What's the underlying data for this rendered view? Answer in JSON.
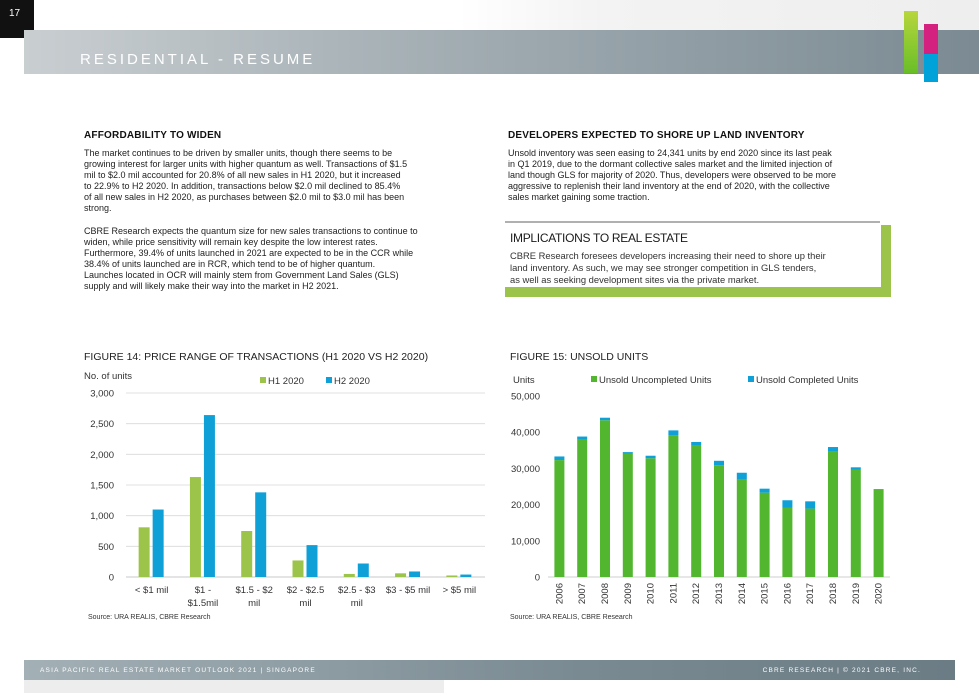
{
  "page": {
    "number": "17",
    "title": "RESIDENTIAL - RESUME"
  },
  "left_section": {
    "heading": "AFFORDABILITY TO WIDEN",
    "paragraph1": [
      "The market continues to be driven by smaller units, though there seems to be",
      "growing interest for larger units with higher quantum as well. Transactions of $1.5",
      "mil to $2.0 mil accounted for 20.8% of all new sales in H1 2020, but it increased",
      "to 22.9% to H2 2020. In addition, transactions below $2.0 mil declined to 85.4%",
      "of all new sales in H2 2020, as purchases between $2.0 mil to $3.0 mil has been",
      "strong."
    ],
    "paragraph2": [
      "CBRE Research expects the quantum size for new sales transactions to continue to",
      "widen, while price sensitivity will remain key despite the low interest rates.",
      "Furthermore, 39.4% of units launched in 2021 are expected to be in the CCR while",
      "38.4% of units launched are in RCR, which tend to be of higher quantum.",
      "Launches located in OCR will mainly stem from Government Land Sales (GLS)",
      "supply and will likely make their way into the market in H2 2021."
    ]
  },
  "right_section": {
    "heading": "DEVELOPERS EXPECTED TO SHORE UP LAND INVENTORY",
    "paragraph": [
      "Unsold inventory was seen easing to 24,341 units by end 2020 since its last peak",
      "in Q1 2019, due to the dormant collective sales market and the limited injection of",
      "land though GLS for majority of 2020. Thus, developers were observed to be more",
      "aggressive to replenish their land inventory at the end of 2020, with the collective",
      "sales market gaining some traction."
    ]
  },
  "implications": {
    "title": "IMPLICATIONS TO REAL ESTATE",
    "text": [
      "CBRE Research foresees developers increasing their need to shore up their",
      "land inventory. As such, we may see stronger competition in GLS tenders,",
      "as well as seeking development sites via the private market."
    ]
  },
  "figures": {
    "fig14_title": "FIGURE 14: PRICE RANGE OF TRANSACTIONS (H1 2020 VS H2 2020)",
    "fig14_source": "Source: URA REALIS, CBRE Research",
    "fig15_title": "FIGURE 15: UNSOLD UNITS",
    "fig15_source": "Source: URA REALIS, CBRE Research"
  },
  "footer": {
    "left": "ASIA PACIFIC REAL ESTATE MARKET OUTLOOK 2021 | SINGAPORE",
    "right": "CBRE RESEARCH | © 2021 CBRE, INC."
  },
  "colors": {
    "green": "#8dc63f",
    "blue": "#00a3d9",
    "bright_green": "#52b72f"
  },
  "chart_data": [
    {
      "type": "bar",
      "title": "FIGURE 14: PRICE RANGE OF TRANSACTIONS (H1 2020 VS H2 2020)",
      "ylabel": "No. of units",
      "xlabel": "",
      "categories": [
        [
          "< $1 mil"
        ],
        [
          "$1 -",
          "$1.5mil"
        ],
        [
          "$1.5 - $2",
          "mil"
        ],
        [
          "$2 - $2.5",
          "mil"
        ],
        [
          "$2.5 - $3",
          "mil"
        ],
        [
          "$3 - $5 mil"
        ],
        [
          "> $5 mil"
        ]
      ],
      "series": [
        {
          "name": "H1 2020",
          "color": "#9dc44a",
          "values": [
            810,
            1630,
            750,
            270,
            50,
            60,
            25
          ]
        },
        {
          "name": "H2 2020",
          "color": "#0fa0d7",
          "values": [
            1100,
            2640,
            1380,
            520,
            220,
            90,
            40
          ]
        }
      ],
      "ylim": [
        0,
        3000
      ],
      "yticks": [
        0,
        500,
        1000,
        1500,
        2000,
        2500,
        3000
      ],
      "ytick_labels": [
        "0",
        "500",
        "1,000",
        "1,500",
        "2,000",
        "2,500",
        "3,000"
      ],
      "grid": true,
      "legend": "top"
    },
    {
      "type": "bar",
      "stacked": true,
      "title": "FIGURE 15: UNSOLD UNITS",
      "ylabel": "Units",
      "xlabel": "",
      "categories": [
        "2006",
        "2007",
        "2008",
        "2009",
        "2010",
        "2011",
        "2012",
        "2013",
        "2014",
        "2015",
        "2016",
        "2017",
        "2018",
        "2019",
        "2020"
      ],
      "series": [
        {
          "name": "Unsold Uncompleted Units",
          "color": "#52b72f",
          "values": [
            32300,
            38000,
            43300,
            34000,
            32800,
            39200,
            36300,
            30900,
            26900,
            23300,
            19200,
            18900,
            34800,
            29700,
            24200
          ]
        },
        {
          "name": "Unsold Completed Units",
          "color": "#0fa0d7",
          "values": [
            1000,
            800,
            700,
            500,
            700,
            1300,
            1000,
            1200,
            1900,
            1100,
            2000,
            2000,
            1100,
            600,
            100
          ]
        }
      ],
      "ylim": [
        0,
        50000
      ],
      "yticks": [
        0,
        10000,
        20000,
        30000,
        40000,
        50000
      ],
      "ytick_labels": [
        "0",
        "10,000",
        "20,000",
        "30,000",
        "40,000",
        "50,000"
      ],
      "grid": false,
      "legend": "top"
    }
  ]
}
